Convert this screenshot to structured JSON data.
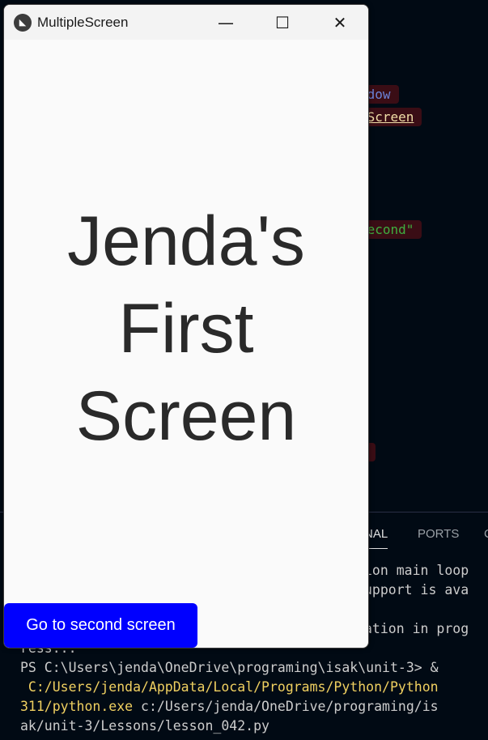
{
  "editor": {
    "code_fragments": [
      {
        "text": "ndow",
        "color": "#6b83d8"
      },
      {
        "text": "DScreen",
        "color": "#f1dfa8"
      },
      {
        "text": "second\"",
        "color": "#3fae3f"
      },
      {
        "text": ")",
        "color": "#e5b800"
      }
    ]
  },
  "panel": {
    "tabs": [
      {
        "label": "NAL",
        "active": true
      },
      {
        "label": "PORTS",
        "active": false
      },
      {
        "label": "C",
        "active": false
      }
    ]
  },
  "terminal": {
    "lines": [
      {
        "text": "ion main loop",
        "color": "#cccccc"
      },
      {
        "text": "upport is ava",
        "color": "#cccccc"
      },
      {
        "text": "ation in prog",
        "color": "#cccccc"
      },
      {
        "text": "ress...",
        "color": "#cccccc"
      },
      {
        "text": "PS C:\\Users\\jenda\\OneDrive\\programing\\isak\\unit-3> &",
        "color": "#cccccc"
      },
      {
        "text": " C:/Users/jenda/AppData/Local/Programs/Python/Python",
        "color": "#f0d060"
      },
      {
        "text": "311/python.exe",
        "color": "#f0d060"
      },
      {
        "text": " c:/Users/jenda/OneDrive/programing/is",
        "color": "#cccccc"
      },
      {
        "text": "ak/unit-3/Lessons/lesson_042.py",
        "color": "#cccccc"
      }
    ]
  },
  "window": {
    "title": "MultipleScreen",
    "icon": "kivy-logo-icon",
    "controls": {
      "minimize": "—",
      "maximize": "☐",
      "close": "✕"
    },
    "heading_lines": [
      "Jenda's",
      "First",
      "Screen"
    ],
    "button_label": "Go to second screen",
    "button_color": "#0000ff"
  }
}
